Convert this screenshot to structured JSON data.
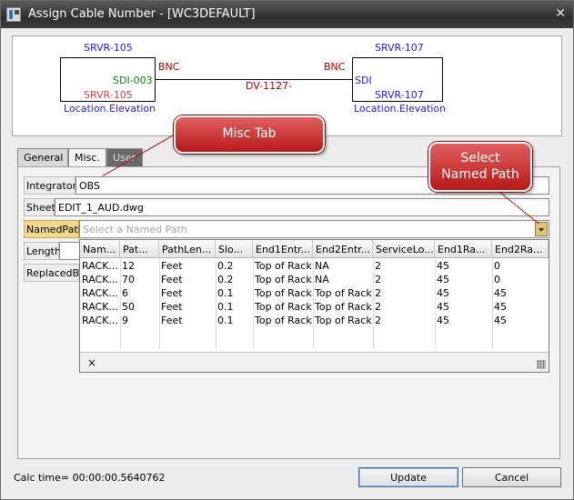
{
  "window": {
    "title": "Assign Cable Number - [WC3DEFAULT]",
    "close": "✕"
  },
  "diagram": {
    "left": {
      "device": "SRVR-105",
      "port": "SDI-003",
      "name": "SRVR-105",
      "location": "Location.Elevation",
      "connector": "BNC"
    },
    "right": {
      "device": "SRVR-107",
      "port": "SDI",
      "name": "SRVR-107",
      "location": "Location.Elevation",
      "connector": "BNC"
    },
    "cable": "DV-1127-"
  },
  "tabs": [
    {
      "label": "General"
    },
    {
      "label": "Misc."
    },
    {
      "label": "User"
    }
  ],
  "fields": {
    "integrator": {
      "label": "Integrator",
      "value": "OBS"
    },
    "sheet": {
      "label": "Sheet",
      "value": "EDIT_1_AUD.dwg"
    },
    "namedpath": {
      "label": "NamedPath",
      "placeholder": "Select a Named Path"
    },
    "length": {
      "label": "Length"
    },
    "replacedby": {
      "label": "ReplacedBY"
    }
  },
  "grid": {
    "columns": [
      "Nam...",
      "Pat...",
      "PathLen...",
      "Slo...",
      "End1Entr...",
      "End2Entr...",
      "ServiceLo...",
      "End1Ra...",
      "End2Ra..."
    ],
    "rows": [
      [
        "RACK...",
        "12",
        "Feet",
        "0.2",
        "Top of Rack",
        "NA",
        "2",
        "45",
        "0"
      ],
      [
        "RACK...",
        "70",
        "Feet",
        "0.2",
        "Top of Rack",
        "NA",
        "2",
        "45",
        "0"
      ],
      [
        "RACK...",
        "6",
        "Feet",
        "0.1",
        "Top of Rack",
        "Top of Rack",
        "2",
        "45",
        "45"
      ],
      [
        "RACK...",
        "50",
        "Feet",
        "0.1",
        "Top of Rack",
        "Top of Rack",
        "2",
        "45",
        "45"
      ],
      [
        "RACK...",
        "9",
        "Feet",
        "0.1",
        "Top of Rack",
        "Top of Rack",
        "2",
        "45",
        "45"
      ]
    ],
    "close": "×"
  },
  "callouts": {
    "misc": "Misc Tab",
    "named_line1": "Select",
    "named_line2": "Named Path"
  },
  "status": {
    "calc_time": "Calc time= 00:00:00.5640762"
  },
  "buttons": {
    "update": "Update",
    "cancel": "Cancel"
  }
}
